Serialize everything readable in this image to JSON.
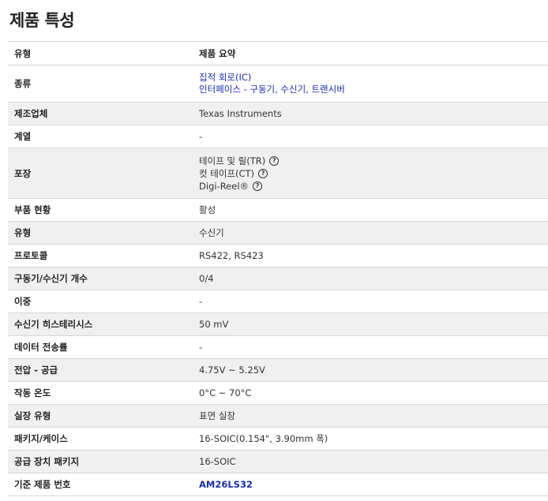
{
  "page_title": "제품 특성",
  "header": {
    "type": "유형",
    "summary": "제품 요약"
  },
  "rows": {
    "category": {
      "label": "종류",
      "links": [
        "집적 회로(IC)",
        "인터페이스 - 구동기, 수신기, 트랜시버"
      ]
    },
    "manufacturer": {
      "label": "제조업체",
      "value": "Texas Instruments"
    },
    "series": {
      "label": "계열",
      "value": "-"
    },
    "packaging": {
      "label": "포장",
      "options": [
        "테이프 및 릴(TR)",
        "컷 테이프(CT)",
        "Digi-Reel®"
      ],
      "help_symbol": "?"
    },
    "part_status": {
      "label": "부품 현황",
      "value": "활성"
    },
    "type": {
      "label": "유형",
      "value": "수신기"
    },
    "protocol": {
      "label": "프로토콜",
      "value": "RS422, RS423"
    },
    "driver_receiver_count": {
      "label": "구동기/수신기 개수",
      "value": "0/4"
    },
    "duplex": {
      "label": "이중",
      "value": "-"
    },
    "receiver_hysteresis": {
      "label": "수신기 히스테리시스",
      "value": "50 mV"
    },
    "data_rate": {
      "label": "데이터 전송률",
      "value": "-"
    },
    "voltage_supply": {
      "label": "전압 - 공급",
      "value": "4.75V ~ 5.25V"
    },
    "operating_temp": {
      "label": "작동 온도",
      "value": "0°C ~ 70°C"
    },
    "mounting_type": {
      "label": "실장 유형",
      "value": "표면 실장"
    },
    "package_case": {
      "label": "패키지/케이스",
      "value": "16-SOIC(0.154\", 3.90mm 폭)"
    },
    "supplier_package": {
      "label": "공급 장치 패키지",
      "value": "16-SOIC"
    },
    "base_part_number": {
      "label": "기준 제품 번호",
      "value": "AM26LS32"
    }
  },
  "colors": {
    "link": "#1b2fa6",
    "row_shade": "#f0f0f0",
    "border": "#d6d6d6"
  }
}
